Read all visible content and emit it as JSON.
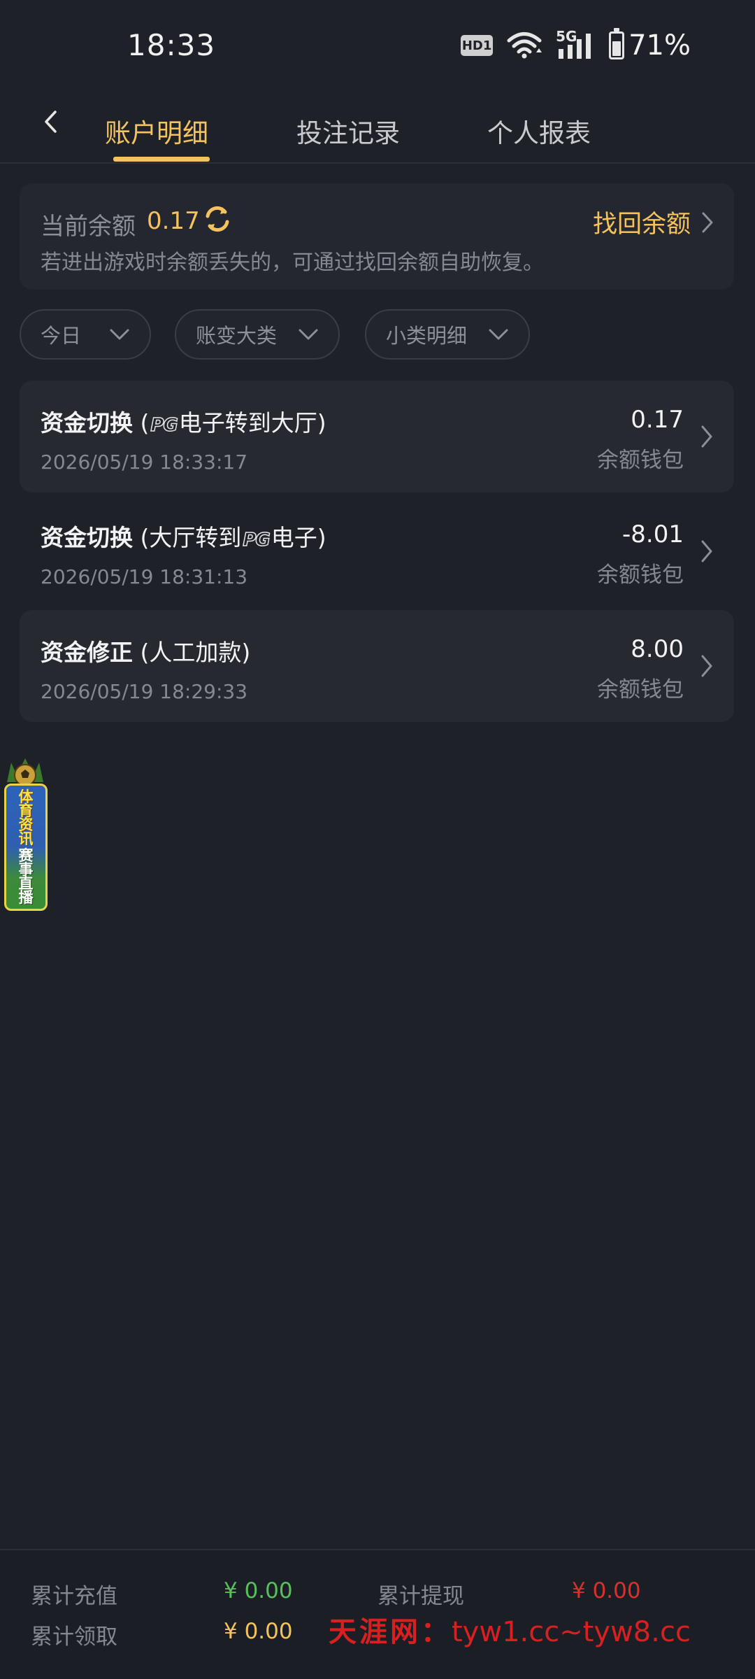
{
  "status_bar": {
    "time": "18:33",
    "network_label": "5G",
    "battery_percent": "71%",
    "battery_level": 0.71,
    "hd_label": "HD1"
  },
  "header": {
    "tabs": [
      {
        "label": "账户明细",
        "active": true
      },
      {
        "label": "投注记录",
        "active": false
      },
      {
        "label": "个人报表",
        "active": false
      }
    ]
  },
  "balance": {
    "label": "当前余额",
    "value": "0.17",
    "recover_label": "找回余额",
    "hint": "若进出游戏时余额丢失的，可通过找回余额自助恢复。"
  },
  "filters": [
    {
      "label": "今日"
    },
    {
      "label": "账变大类"
    },
    {
      "label": "小类明细"
    }
  ],
  "records": [
    {
      "title_bold": "资金切换",
      "title_prefix": " (",
      "title_logo": "PG",
      "title_rest": "电子转到大厅)",
      "date": "2026/05/19 18:33:17",
      "amount": "0.17",
      "wallet": "余额钱包"
    },
    {
      "title_bold": "资金切换",
      "title_prefix": " (大厅转到",
      "title_logo": "PG",
      "title_rest": "电子)",
      "date": "2026/05/19 18:31:13",
      "amount": "-8.01",
      "wallet": "余额钱包"
    },
    {
      "title_bold": "资金修正",
      "title_prefix": " (人工加款)",
      "title_logo": "",
      "title_rest": "",
      "date": "2026/05/19 18:29:33",
      "amount": "8.00",
      "wallet": "余额钱包"
    }
  ],
  "sports_banner": {
    "line1": [
      "体",
      "育",
      "资",
      "讯"
    ],
    "line2": [
      "赛",
      "事",
      "直",
      "播"
    ]
  },
  "footer": {
    "total_deposit_label": "累计充值",
    "total_deposit_value": "¥ 0.00",
    "total_withdraw_label": "累计提现",
    "total_withdraw_value": "¥ 0.00",
    "total_claim_label": "累计领取",
    "total_claim_value": "¥ 0.00",
    "watermark_cn": "天涯网：",
    "watermark_url": "tyw1.cc~tyw8.cc"
  },
  "colors": {
    "accent": "#f4c35d",
    "deposit": "#56c15a",
    "withdraw": "#d9302c",
    "claim": "#f4c35d"
  }
}
